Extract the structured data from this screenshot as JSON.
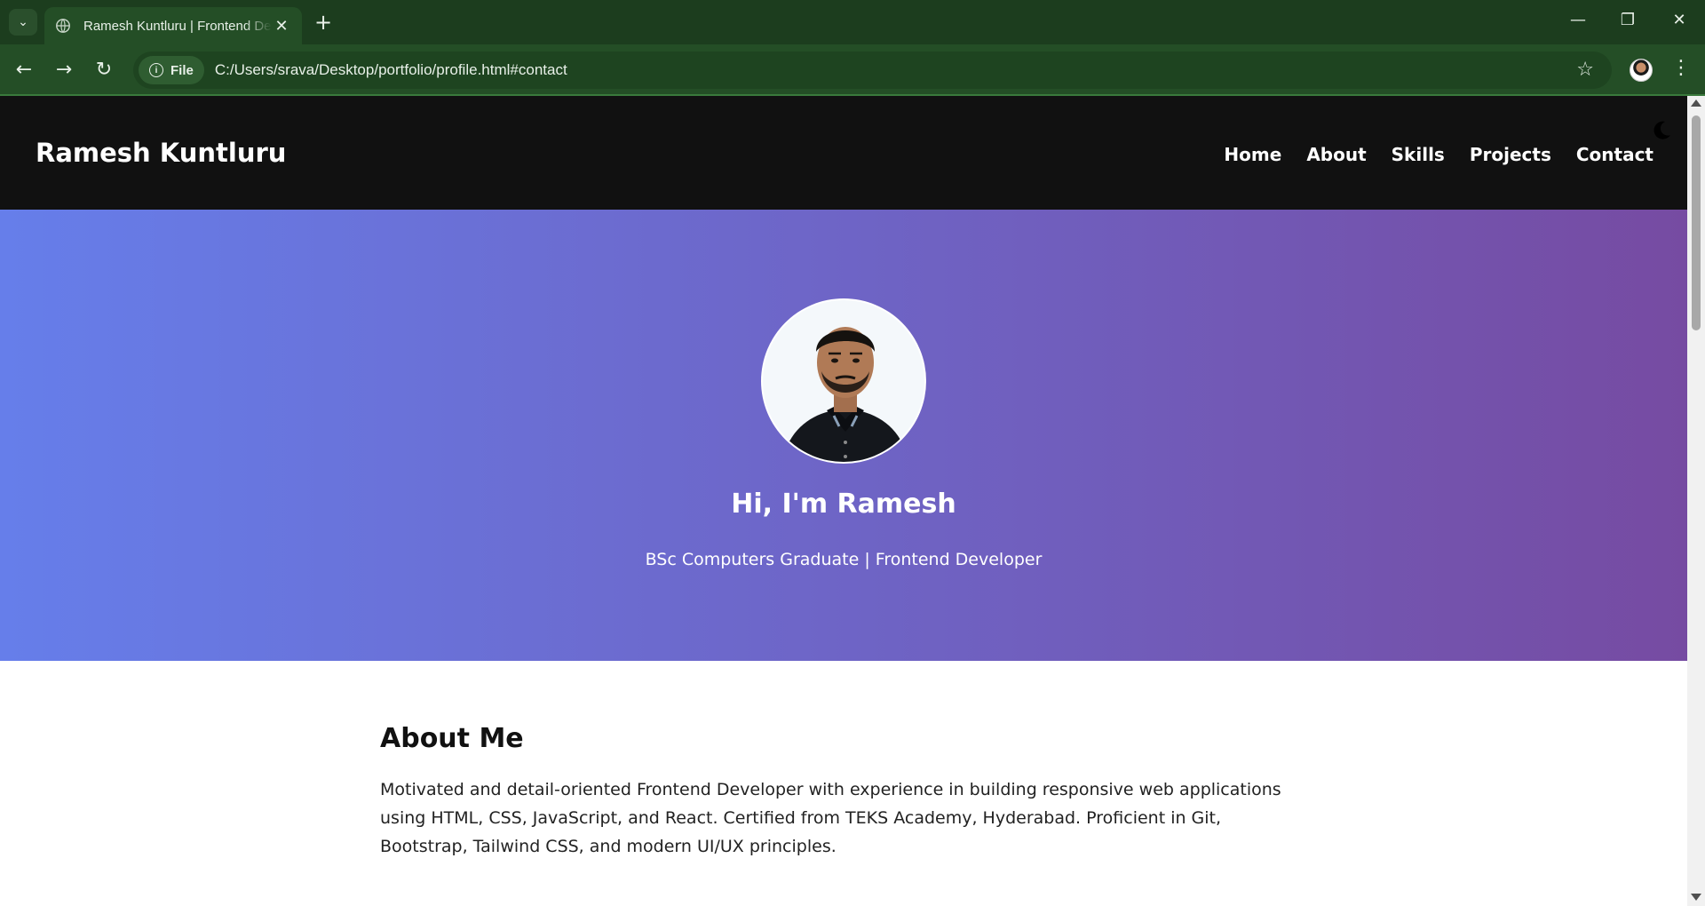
{
  "browser": {
    "tab_title": "Ramesh Kuntluru | Frontend Developer",
    "chip_label": "File",
    "url": "C:/Users/srava/Desktop/portfolio/profile.html#contact",
    "icons": [
      "tab-search-icon",
      "globe-icon",
      "close-icon",
      "new-tab-icon",
      "minimize-icon",
      "restore-icon",
      "window-close-icon",
      "back-icon",
      "forward-icon",
      "reload-icon",
      "info-icon",
      "bookmark-star-icon",
      "profile-avatar",
      "menu-kebab-icon"
    ]
  },
  "site": {
    "logo": "Ramesh Kuntluru",
    "nav": [
      "Home",
      "About",
      "Skills",
      "Projects",
      "Contact"
    ],
    "theme_toggle_icon": "moon-icon"
  },
  "hero": {
    "title": "Hi, I'm Ramesh",
    "subtitle": "BSc Computers Graduate | Frontend Developer",
    "gradient_start": "#667eea",
    "gradient_end": "#764ba2"
  },
  "about": {
    "heading": "About Me",
    "text": "Motivated and detail-oriented Frontend Developer with experience in building responsive web applications using HTML, CSS, JavaScript, and React. Certified from TEKS Academy, Hyderabad. Proficient in Git, Bootstrap, Tailwind CSS, and modern UI/UX principles."
  }
}
